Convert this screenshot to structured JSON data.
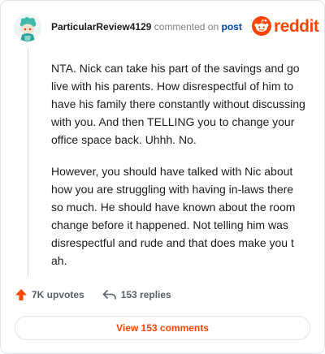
{
  "comment": {
    "username": "ParticularReview4129",
    "action_text": "commented on",
    "post_link": "post",
    "brand": "reddit",
    "paragraphs": [
      "NTA. Nick can take his part of the savings and go live with his parents. How disrespectful of him to have his family there constantly without discussing with you. And then TELLING you to change your office space back. Uhhh. No.",
      "However, you should have talked with Nic about how you are struggling with having in-laws there so much. He should have known about the room change before it happened. Not telling him was disrespectful and rude and that does make you t ah."
    ],
    "upvotes": "7K upvotes",
    "replies": "153 replies",
    "view_comments_label": "View 153 comments"
  },
  "colors": {
    "brand": "#ff4500",
    "link": "#0045ac",
    "upvote": "#ff4500",
    "muted": "#7c8287"
  },
  "icons": {
    "avatar": "snoo-avatar",
    "logo": "reddit-snoo-icon",
    "upvote": "upvote-arrow-icon",
    "reply": "reply-arrow-icon"
  }
}
